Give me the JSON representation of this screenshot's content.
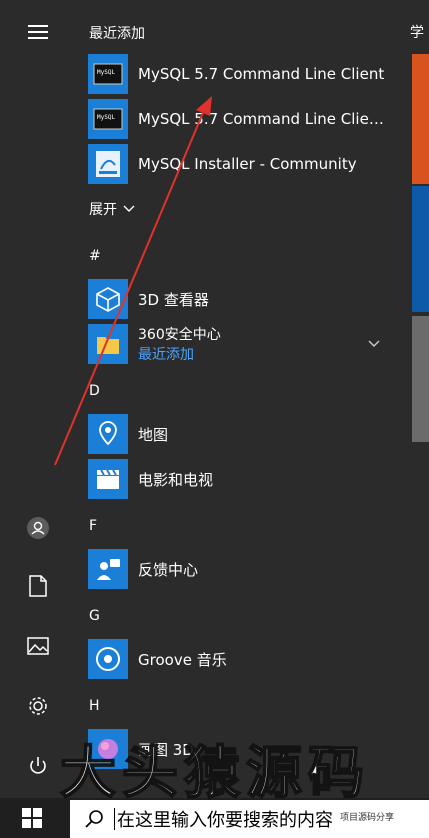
{
  "recent": {
    "heading": "最近添加",
    "items": [
      {
        "label": "MySQL 5.7 Command Line Client",
        "icon": "terminal-icon"
      },
      {
        "label": "MySQL 5.7 Command Line Client...",
        "icon": "terminal-icon"
      },
      {
        "label": "MySQL Installer - Community",
        "icon": "installer-icon"
      }
    ],
    "expand_label": "展开"
  },
  "groups": [
    {
      "letter": "#",
      "apps": [
        {
          "label": "3D 查看器",
          "icon": "cube-icon"
        },
        {
          "label": "360安全中心",
          "sub": "最近添加",
          "icon": "folder-icon"
        }
      ]
    },
    {
      "letter": "D",
      "apps": [
        {
          "label": "地图",
          "icon": "map-pin-icon"
        },
        {
          "label": "电影和电视",
          "icon": "clapperboard-icon"
        }
      ]
    },
    {
      "letter": "F",
      "apps": [
        {
          "label": "反馈中心",
          "icon": "feedback-icon"
        }
      ]
    },
    {
      "letter": "G",
      "apps": [
        {
          "label": "Groove 音乐",
          "icon": "music-disc-icon"
        }
      ]
    },
    {
      "letter": "H",
      "apps": [
        {
          "label": "画图 3D",
          "icon": "paint-3d-icon"
        }
      ]
    }
  ],
  "tiles_heading": "学",
  "search_placeholder": "在这里输入你要搜索的内容",
  "watermark_large": "大头猿源码",
  "watermark_small": "项目源码分享",
  "colors": {
    "accent_blue": "#1c7fd7",
    "tile_orange": "#d9531e",
    "tile_blue": "#0f5aa8",
    "tile_gray": "#6b6b6b",
    "arrow_red": "#e0322b"
  }
}
